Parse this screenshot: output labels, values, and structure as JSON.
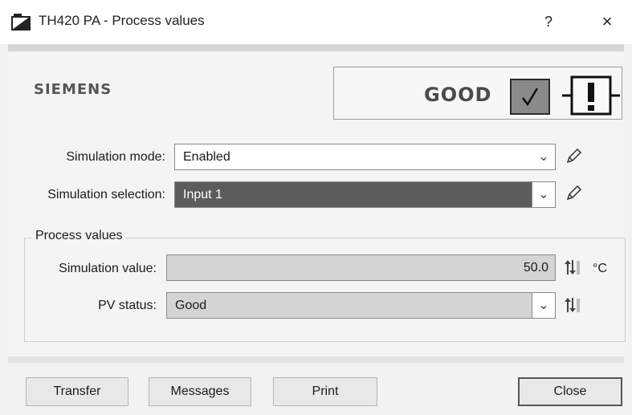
{
  "window": {
    "title": "TH420 PA - Process values",
    "help": "?",
    "close": "×"
  },
  "header": {
    "brand": "SIEMENS",
    "status": "GOOD",
    "check_icon": "check-icon",
    "warning_icon": "exclamation-icon"
  },
  "form": {
    "simulation_mode_label": "Simulation mode:",
    "simulation_mode_value": "Enabled",
    "simulation_selection_label": "Simulation selection:",
    "simulation_selection_value": "Input 1"
  },
  "process_values": {
    "group_title": "Process values",
    "simulation_value_label": "Simulation value:",
    "simulation_value": "50.0",
    "unit": "°C",
    "pv_status_label": "PV status:",
    "pv_status_value": "Good"
  },
  "buttons": {
    "transfer": "Transfer",
    "messages": "Messages",
    "print": "Print",
    "close": "Close"
  },
  "colors": {
    "selected_combo": "#5c5c5c",
    "readonly_field": "#d4d4d4",
    "status_box": "#8a8a8a"
  }
}
